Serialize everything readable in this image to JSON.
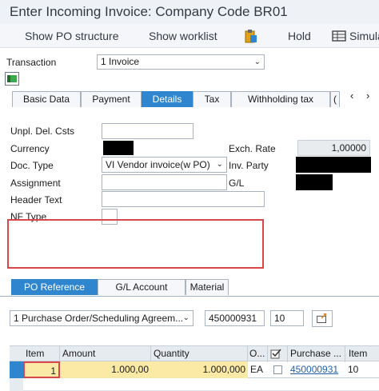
{
  "window": {
    "title": "Enter Incoming Invoice: Company Code BR01"
  },
  "toolbar": {
    "show_po_structure": "Show PO structure",
    "show_worklist": "Show worklist",
    "hold": "Hold",
    "simulate": "Simula"
  },
  "transaction": {
    "label": "Transaction",
    "value": "1 Invoice"
  },
  "header_tabs": [
    "Basic Data",
    "Payment",
    "Details",
    "Tax",
    "Withholding tax",
    "("
  ],
  "details": {
    "unpl_del_csts_label": "Unpl. Del. Csts",
    "unpl_del_csts_value": "",
    "currency_label": "Currency",
    "exch_rate_label": "Exch. Rate",
    "exch_rate_value": "1,00000",
    "doc_type_label": "Doc. Type",
    "doc_type_value": "VI Vendor invoice(w PO)",
    "inv_party_label": "Inv. Party",
    "assignment_label": "Assignment",
    "assignment_value": "",
    "gl_label": "G/L",
    "header_text_label": "Header Text",
    "header_text_value": "",
    "nf_type_label": "NF Type",
    "nf_type_value": ""
  },
  "item_tabs": [
    "PO Reference",
    "G/L Account",
    "Material"
  ],
  "reference": {
    "type_value": "1 Purchase Order/Scheduling Agreem...",
    "po_number": "450000931",
    "po_item": "10"
  },
  "grid": {
    "headers": [
      "Item",
      "Amount",
      "Quantity",
      "O...",
      "Purchase ...",
      "Item"
    ],
    "rows": [
      {
        "item": "1",
        "amount": "1.000,00",
        "quantity": "1.000,000",
        "unit": "EA",
        "po": "450000931",
        "po_item": "10"
      }
    ]
  },
  "colors": {
    "active_tab": "#2f86cf",
    "highlight_cell": "#fbe9a6",
    "annotation_box": "#d9474b"
  }
}
